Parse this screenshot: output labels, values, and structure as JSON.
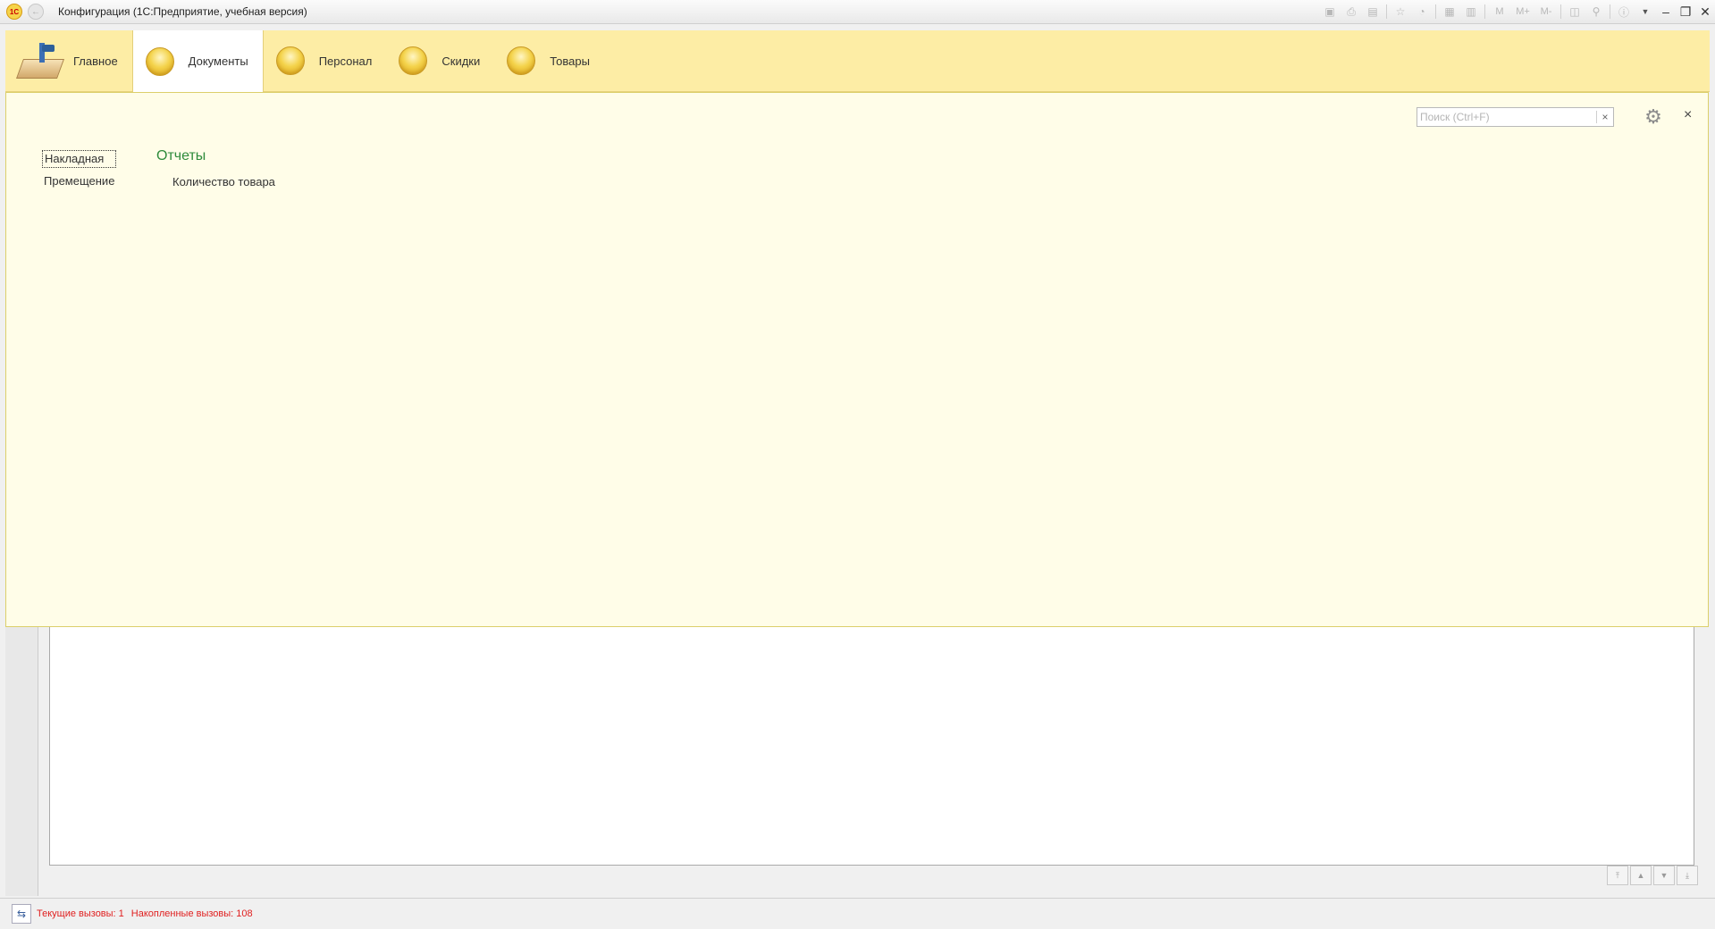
{
  "window": {
    "title": "Конфигурация  (1С:Предприятие, учебная версия)",
    "logo_text": "1С",
    "toolbar_labels": [
      "M",
      "M+",
      "M-"
    ]
  },
  "sections": [
    {
      "label": "Главное",
      "icon": "desk-lamp-icon"
    },
    {
      "label": "Документы",
      "icon": "yellow-circle-icon",
      "active": true
    },
    {
      "label": "Персонал",
      "icon": "yellow-circle-icon"
    },
    {
      "label": "Скидки",
      "icon": "yellow-circle-icon"
    },
    {
      "label": "Товары",
      "icon": "yellow-circle-icon"
    }
  ],
  "function_panel": {
    "search_placeholder": "Поиск (Ctrl+F)",
    "nav_items": [
      "Накладная",
      "Премещение"
    ],
    "reports_title": "Отчеты",
    "reports": [
      "Количество товара"
    ]
  },
  "statusbar": {
    "current_calls": "Текущие вызовы: 1",
    "accumulated_calls": "Накопленные вызовы: 108"
  },
  "colors": {
    "section_bg": "#fdeda5",
    "panel_bg": "#fffde8",
    "reports_title": "#2e8b3b",
    "status_text": "#e02020"
  }
}
